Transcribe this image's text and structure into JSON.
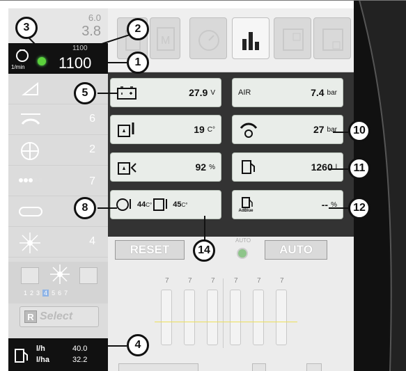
{
  "engine": {
    "small_top_value": "6.0",
    "large_top_value": "3.8",
    "setpoint_rpm": "1100",
    "rpm_value": "1100",
    "rpm_unit": "1/min"
  },
  "callouts": [
    "1",
    "2",
    "3",
    "4",
    "5",
    "8",
    "10",
    "11",
    "12",
    "14"
  ],
  "sidebar": {
    "rows": [
      {
        "icon": "mower-conditioner-icon",
        "value": ""
      },
      {
        "icon": "swath-width-icon",
        "value": "6"
      },
      {
        "icon": "reel-wheel-icon",
        "value": "2"
      },
      {
        "icon": "row-dots-icon",
        "value": "7"
      },
      {
        "icon": "conveyor-icon",
        "value": "5"
      },
      {
        "icon": "fan-icon",
        "value": "4"
      }
    ],
    "scale": [
      "1",
      "2",
      "3",
      "4",
      "5",
      "6",
      "7"
    ],
    "scale_selected": "4",
    "select_label": "Select",
    "fuel": {
      "l_h_unit": "l/h",
      "l_h_value": "40.0",
      "l_ha_unit": "l/ha",
      "l_ha_value": "32.2"
    }
  },
  "readings": {
    "voltage": {
      "value": "27.9",
      "unit": "V"
    },
    "air": {
      "label": "AIR",
      "value": "7.4",
      "unit": "bar"
    },
    "oil_temp": {
      "value": "19",
      "unit": "C°"
    },
    "pressure": {
      "value": "27",
      "unit": "bar"
    },
    "oil_level": {
      "value": "92",
      "unit": "%"
    },
    "fuel_level": {
      "value": "1260",
      "unit": "l"
    },
    "temp_a": {
      "value": "44",
      "unit": "C°"
    },
    "temp_b": {
      "value": "45",
      "unit": "C°"
    },
    "adblue": {
      "label": "AdBlue",
      "value": "--",
      "unit": "%"
    }
  },
  "controls": {
    "reset_label": "RESET",
    "auto_small": "AUTO",
    "auto_button": "AUTO",
    "slider_values": [
      "7",
      "7",
      "7",
      "7",
      "7",
      "7"
    ]
  }
}
